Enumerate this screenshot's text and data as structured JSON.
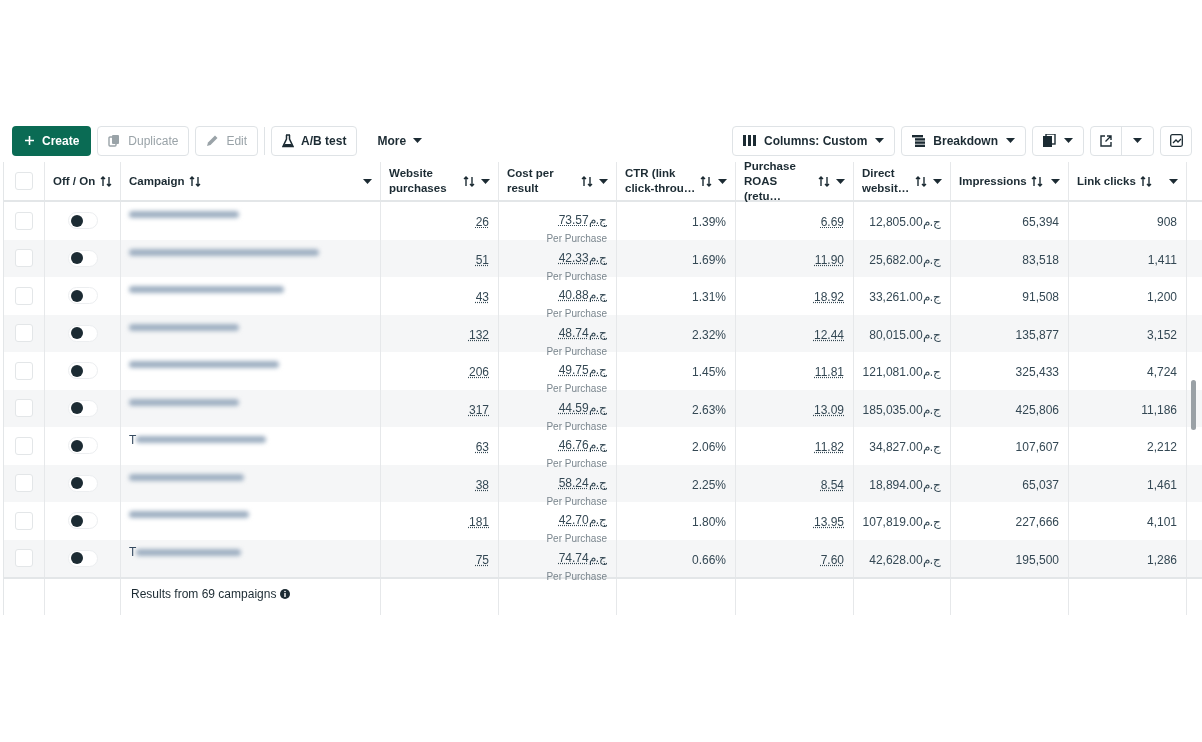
{
  "toolbar": {
    "left": [
      {
        "kind": "primary",
        "label": "Create",
        "disabled": false
      },
      {
        "kind": "plain",
        "label": "Duplicate",
        "disabled": true
      },
      {
        "kind": "plain",
        "label": "Edit",
        "disabled": true
      },
      {
        "kind": "plain",
        "label": "A/B test",
        "disabled": false
      },
      {
        "kind": "menu",
        "label": "More",
        "disabled": false
      }
    ],
    "right": [
      {
        "kind": "dropdown",
        "label": "Columns: Custom"
      },
      {
        "kind": "dropdown",
        "label": "Breakdown"
      }
    ]
  },
  "table": {
    "select_all": {
      "checked": false
    },
    "columns": [
      {
        "label": "Off / On"
      },
      {
        "label": "Campaign"
      },
      {
        "label": "Website purchases"
      },
      {
        "label": "Cost per result"
      },
      {
        "label": "CTR (link click-throu…"
      },
      {
        "label": "Purchase ROAS (retu…"
      },
      {
        "label": "Direct websit…"
      },
      {
        "label": "Impressions"
      },
      {
        "label": "Link clicks"
      }
    ],
    "rows": [
      {
        "checked": false,
        "on": false,
        "purchases": "26",
        "cost": "73.57ج.م",
        "cost_label": "Per Purchase",
        "ctr": "1.39%",
        "roas": "6.69",
        "direct": "12,805.00ج.م",
        "impressions": "65,394",
        "clicks": "908"
      },
      {
        "checked": false,
        "on": false,
        "purchases": "51",
        "cost": "42.33ج.م",
        "cost_label": "Per Purchase",
        "ctr": "1.69%",
        "roas": "11.90",
        "direct": "25,682.00ج.م",
        "impressions": "83,518",
        "clicks": "1,411"
      },
      {
        "checked": false,
        "on": false,
        "purchases": "43",
        "cost": "40.88ج.م",
        "cost_label": "Per Purchase",
        "ctr": "1.31%",
        "roas": "18.92",
        "direct": "33,261.00ج.م",
        "impressions": "91,508",
        "clicks": "1,200"
      },
      {
        "checked": false,
        "on": false,
        "purchases": "132",
        "cost": "48.74ج.م",
        "cost_label": "Per Purchase",
        "ctr": "2.32%",
        "roas": "12.44",
        "direct": "80,015.00ج.م",
        "impressions": "135,877",
        "clicks": "3,152"
      },
      {
        "checked": false,
        "on": false,
        "purchases": "206",
        "cost": "49.75ج.م",
        "cost_label": "Per Purchase",
        "ctr": "1.45%",
        "roas": "11.81",
        "direct": "121,081.00ج.م",
        "impressions": "325,433",
        "clicks": "4,724"
      },
      {
        "checked": false,
        "on": false,
        "purchases": "317",
        "cost": "44.59ج.م",
        "cost_label": "Per Purchase",
        "ctr": "2.63%",
        "roas": "13.09",
        "direct": "185,035.00ج.م",
        "impressions": "425,806",
        "clicks": "11,186"
      },
      {
        "checked": false,
        "on": false,
        "name_start": "T",
        "purchases": "63",
        "cost": "46.76ج.م",
        "cost_label": "Per Purchase",
        "ctr": "2.06%",
        "roas": "11.82",
        "direct": "34,827.00ج.م",
        "impressions": "107,607",
        "clicks": "2,212"
      },
      {
        "checked": false,
        "on": false,
        "purchases": "38",
        "cost": "58.24ج.م",
        "cost_label": "Per Purchase",
        "ctr": "2.25%",
        "roas": "8.54",
        "direct": "18,894.00ج.م",
        "impressions": "65,037",
        "clicks": "1,461"
      },
      {
        "checked": false,
        "on": false,
        "purchases": "181",
        "cost": "42.70ج.م",
        "cost_label": "Per Purchase",
        "ctr": "1.80%",
        "roas": "13.95",
        "direct": "107,819.00ج.م",
        "impressions": "227,666",
        "clicks": "4,101"
      },
      {
        "checked": false,
        "on": false,
        "name_start": "T",
        "purchases": "75",
        "cost": "74.74ج.م",
        "cost_label": "Per Purchase",
        "ctr": "0.66%",
        "roas": "7.60",
        "direct": "42,628.00ج.م",
        "impressions": "195,500",
        "clicks": "1,286"
      }
    ],
    "footer": "Results from 69 campaigns"
  }
}
